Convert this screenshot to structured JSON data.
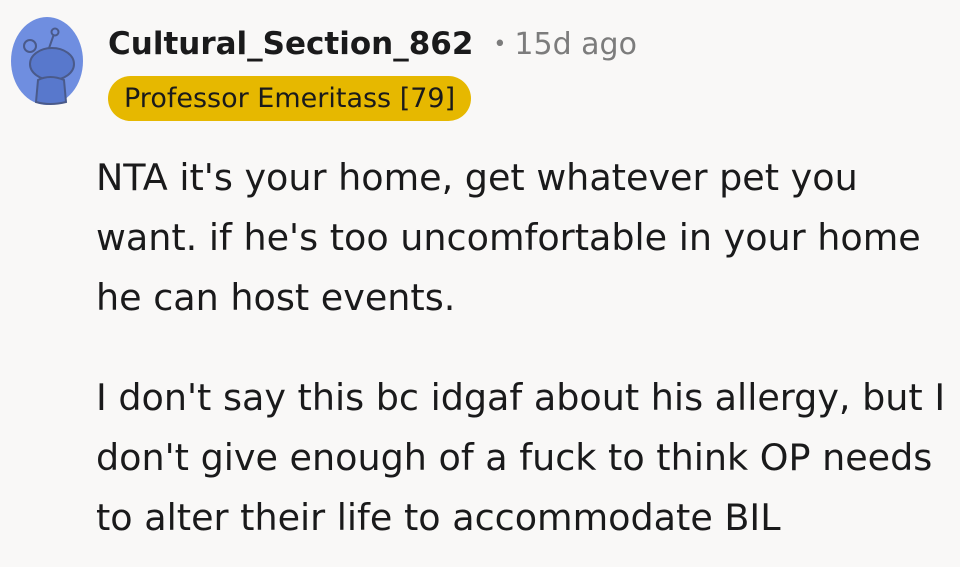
{
  "comment": {
    "author": "Cultural_Section_862",
    "separator": "•",
    "timestamp": "15d ago",
    "flair": "Professor Emeritass [79]",
    "avatar_icon": "snoo-avatar-icon",
    "paragraphs": [
      "NTA it's your home, get whatever pet you want. if he's too uncomfortable in your home he can host events.",
      "I don't say this bc idgaf about his allergy, but I don't give enough of a fuck to think OP needs to alter their life to accommodate BIL"
    ]
  },
  "colors": {
    "background": "#f9f8f7",
    "flair_bg": "#e6b800",
    "avatar_bg": "#6f8ee0",
    "meta_text": "#7c7c7c"
  }
}
